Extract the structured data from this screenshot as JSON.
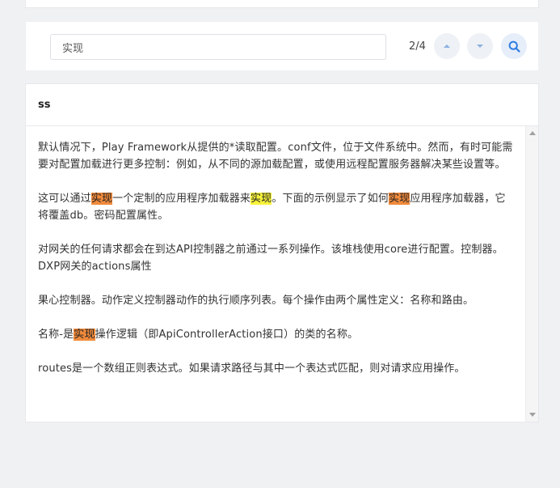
{
  "search": {
    "value": "实现",
    "match_count": "2/4"
  },
  "icons": {
    "prev": "chevron-up-icon",
    "next": "chevron-down-icon",
    "search": "search-icon"
  },
  "colors": {
    "accent": "#2f7de1",
    "current_match": "#f08a3c",
    "match": "#f7f23a"
  },
  "document": {
    "title": "ss",
    "paragraphs": [
      {
        "segments": [
          {
            "text": "默认情况下，Play Framework从提供的*读取配置。conf文件，位于文件系统中。然而，有时可能需要对配置加载进行更多控制：例如，从不同的源加载配置，或使用远程配置服务器解决某些设置等。"
          }
        ]
      },
      {
        "segments": [
          {
            "text": "这可以通过"
          },
          {
            "text": "实现",
            "highlight": "current"
          },
          {
            "text": "一个定制的应用程序加载器来"
          },
          {
            "text": "实现",
            "highlight": "match"
          },
          {
            "text": "。下面的示例显示了如何"
          },
          {
            "text": "实现",
            "highlight": "current"
          },
          {
            "text": "应用程序加载器，它将覆盖db。密码配置属性。"
          }
        ]
      },
      {
        "segments": [
          {
            "text": "对网关的任何请求都会在到达API控制器之前通过一系列操作。该堆栈使用core进行配置。控制器。DXP网关的actions属性"
          }
        ]
      },
      {
        "segments": [
          {
            "text": "果心控制器。动作定义控制器动作的执行顺序列表。每个操作由两个属性定义：名称和路由。"
          }
        ]
      },
      {
        "segments": [
          {
            "text": "名称-是"
          },
          {
            "text": "实现",
            "highlight": "current"
          },
          {
            "text": "操作逻辑（即ApiControllerAction接口）的类的名称。"
          }
        ]
      },
      {
        "segments": [
          {
            "text": "routes是一个数组正则表达式。如果请求路径与其中一个表达式匹配，则对请求应用操作。"
          }
        ]
      }
    ]
  }
}
